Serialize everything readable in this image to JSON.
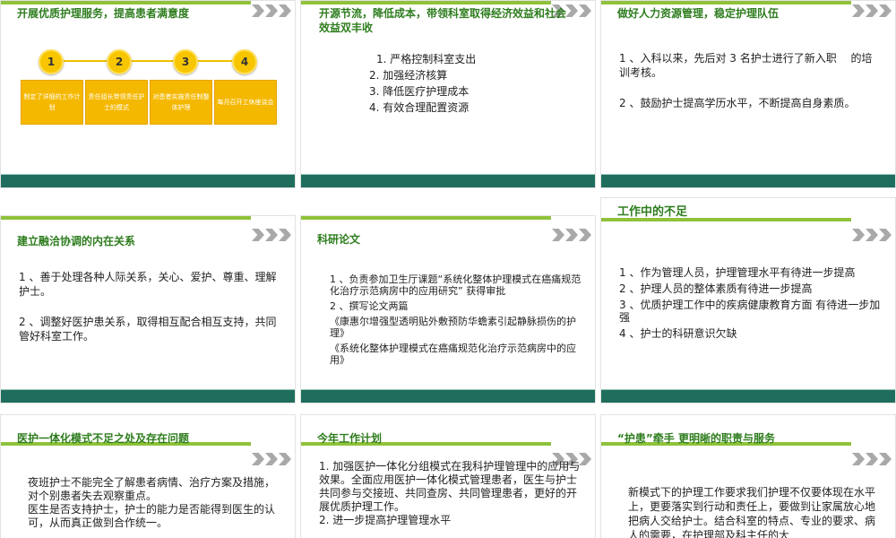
{
  "slides": {
    "s1": {
      "title": "开展优质护理服务，提高患者满意度",
      "steps": [
        "1",
        "2",
        "3",
        "4"
      ],
      "boxes": [
        "制定了详细的工作计划",
        "责任组长带领责任护士的模式",
        "对患者实施责任制整体护理",
        "每月召开工休座谈会"
      ]
    },
    "s2": {
      "title": "开源节流，降低成本，带领科室取得经济效益和社会效益双丰收",
      "items": [
        "1. 严格控制科室支出",
        "2. 加强经济核算",
        "3. 降低医疗护理成本",
        "4. 有效合理配置资源"
      ]
    },
    "s3": {
      "title": "做好人力资源管理，稳定护理队伍",
      "items": [
        "1 、入科以来，先后对 3 名护士进行了新入职　 的培训考核。",
        "2 、鼓励护士提高学历水平，不断提高自身素质。"
      ]
    },
    "s4": {
      "title": "建立融洽协调的内在关系",
      "items": [
        "1 、善于处理各种人际关系，关心、爱护、尊重、理解护士。",
        "2 、调整好医护患关系，取得相互配合相互支持，共同管好科室工作。"
      ]
    },
    "s5": {
      "title": "科研论文",
      "items": [
        "1 、负责参加卫生厅课题“系统化整体护理模式在癌痛规范化治疗示范病房中的应用研究” 获得审批",
        "2 、撰写论文两篇",
        "《康惠尔增强型透明贴外敷预防华蟾素引起静脉损伤的护理》",
        "《系统化整体护理模式在癌痛规范化治疗示范病房中的应用》"
      ]
    },
    "s6": {
      "title": "工作中的不足",
      "items": [
        "1 、作为管理人员，护理管理水平有待进一步提高",
        "2 、护理人员的整体素质有待进一步提高",
        "3 、优质护理工作中的疾病健康教育方面 有待进一步加强",
        "4 、护士的科研意识欠缺"
      ]
    },
    "s7": {
      "title": "医护一体化模式不足之处及存在问题",
      "items": [
        "夜班护士不能完全了解患者病情、治疗方案及措施，对个别患者失去观察重点。",
        "医生是否支持护士，护士的能力是否能得到医生的认可，从而真正做到合作统一。"
      ]
    },
    "s8": {
      "title": "今年工作计划",
      "items": [
        "1. 加强医护一体化分组模式在我科护理管理中的应用与效果。全面应用医护一体化模式管理患者，医生与护士共同参与交接班、共同查房、共同管理患者，更好的开展优质护理工作。",
        "2. 进一步提高护理管理水平"
      ]
    },
    "s9": {
      "title": "“护患”牵手 更明晰的职责与服务",
      "items": [
        "新模式下的护理工作要求我们护理不仅要体现在水平上，更要落实到行动和责任上，要做到让家属放心地把病人交给护士。结合科室的特点、专业的要求、病人的需要，在护理部及科主任的大"
      ]
    }
  },
  "colors": {
    "accent": "#2e7d1e",
    "bar": "#8fc23a",
    "footer": "#1f6e5d",
    "step": "#f7c600"
  }
}
